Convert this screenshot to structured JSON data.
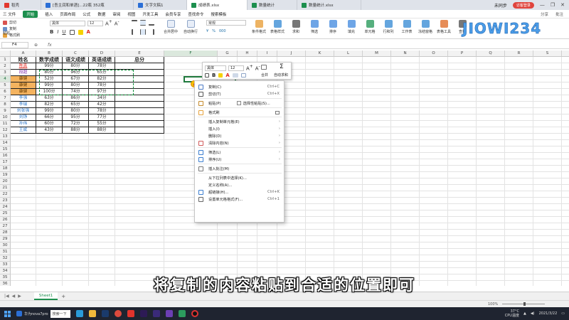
{
  "colors": {
    "accent": "#1d8f4e",
    "orange_fill": "#f4b35f",
    "red_text": "#e0241b",
    "purple_text": "#7a28a8",
    "blue_text": "#2e77c9",
    "selection": "#1f7a3d"
  },
  "tabs": [
    {
      "label": "稻壳",
      "icon": "docer-icon",
      "color": "#e2382e"
    },
    {
      "label": "[吾主润和单酒]...22瓶 352瓶",
      "icon": "doc-icon",
      "color": "#2b6fd6"
    },
    {
      "label": "文字文稿1",
      "icon": "doc-icon",
      "color": "#2b6fd6"
    },
    {
      "label": "成绩表.xlsx",
      "icon": "sheet-icon",
      "color": "#1d8f4e",
      "active": true
    },
    {
      "label": "数量统计",
      "icon": "sheet-icon",
      "color": "#1d8f4e"
    },
    {
      "label": "数量统计.xlsx",
      "icon": "sheet-icon",
      "color": "#1d8f4e"
    }
  ],
  "titlebar": {
    "unlogged": "未同步",
    "vip": "访客登录"
  },
  "menu": {
    "items": [
      "三 文件",
      "开始",
      "插入",
      "页面布局",
      "公式",
      "数据",
      "审阅",
      "视图",
      "开发工具",
      "会员专享",
      "查找命令",
      "搜索模板"
    ],
    "active_index": 1,
    "right": [
      "分享",
      "批注"
    ]
  },
  "ribbon": {
    "cut": "剪切",
    "copy": "复制",
    "format_painter": "格式刷",
    "paste": "粘贴",
    "font": "黑体",
    "size": "12",
    "merge": "合并居中",
    "wrap": "自动换行",
    "numfmt": "常规",
    "large": [
      "条件格式",
      "表格样式",
      "求和",
      "筛选",
      "排序",
      "填充",
      "单元格",
      "行和列",
      "工作表",
      "冻结窗格",
      "表格工具",
      "查找"
    ]
  },
  "watermark": "JIOWI234",
  "formula_bar": {
    "cell_ref": "F4",
    "fx": "fx"
  },
  "columns": [
    "A",
    "B",
    "C",
    "D",
    "E",
    "F",
    "G",
    "H",
    "I",
    "J",
    "K",
    "L",
    "M",
    "N",
    "O",
    "P",
    "Q",
    "R",
    "S",
    "T",
    "U",
    "V"
  ],
  "table": {
    "headers": [
      "姓名",
      "数学成绩",
      "语文成绩",
      "英语成绩",
      "总分"
    ],
    "rows": [
      {
        "name": "陈真",
        "math": "99分",
        "chinese": "80分",
        "english": "78分",
        "style": "red"
      },
      {
        "name": "段超",
        "math": "80分",
        "chinese": "96分",
        "english": "65分",
        "style": "purple"
      },
      {
        "name": "康健",
        "math": "52分",
        "chinese": "67分",
        "english": "82分",
        "style": "orange"
      },
      {
        "name": "康健",
        "math": "99分",
        "chinese": "80分",
        "english": "78分",
        "style": "orange"
      },
      {
        "name": "康健",
        "math": "100分",
        "chinese": "74分",
        "english": "97分",
        "style": "orange"
      },
      {
        "name": "李强",
        "math": "63分",
        "chinese": "86分",
        "english": "34分",
        "style": "blue"
      },
      {
        "name": "李瑞",
        "math": "82分",
        "chinese": "65分",
        "english": "42分",
        "style": "blue"
      },
      {
        "name": "刘张强",
        "math": "99分",
        "chinese": "80分",
        "english": "78分",
        "style": "blue"
      },
      {
        "name": "刘铮",
        "math": "66分",
        "chinese": "95分",
        "english": "77分",
        "style": "blue"
      },
      {
        "name": "孙伟",
        "math": "60分",
        "chinese": "72分",
        "english": "55分",
        "style": "blue"
      },
      {
        "name": "王斌",
        "math": "43分",
        "chinese": "88分",
        "english": "88分",
        "style": "blue"
      }
    ]
  },
  "row_count": 36,
  "mini_toolbar": {
    "font": "黑体",
    "size": "12",
    "merge": "合并",
    "autosum": "自动求和"
  },
  "context_menu": [
    {
      "label": "复制(C)",
      "shortcut": "Ctrl+C",
      "icon": "copy-icon"
    },
    {
      "label": "剪切(T)",
      "shortcut": "Ctrl+X",
      "icon": "scissors-icon"
    },
    {
      "sep": true
    },
    {
      "label": "粘贴(P)",
      "shortcut": "",
      "icon": "paste-icon",
      "extra": "选择性粘贴(S)..."
    },
    {
      "sep": true
    },
    {
      "label": "格式刷",
      "shortcut": "",
      "icon": "brush-icon"
    },
    {
      "sep": true
    },
    {
      "label": "插入复制单元格(E)",
      "shortcut": "",
      "icon": "",
      "arrow": true
    },
    {
      "label": "插入(I)",
      "shortcut": "",
      "icon": "",
      "arrow": true
    },
    {
      "label": "删除(D)",
      "shortcut": "",
      "icon": "",
      "arrow": true
    },
    {
      "label": "清除内容(N)",
      "shortcut": "",
      "icon": "eraser-icon",
      "arrow": true
    },
    {
      "sep": true
    },
    {
      "label": "筛选(L)",
      "shortcut": "",
      "icon": "filter-icon",
      "arrow": true
    },
    {
      "label": "排序(U)",
      "shortcut": "",
      "icon": "sort-icon",
      "arrow": true
    },
    {
      "sep": true
    },
    {
      "label": "插入批注(M)",
      "shortcut": "",
      "icon": "comment-icon"
    },
    {
      "sep": true
    },
    {
      "label": "从下拉列表中选择(K)...",
      "shortcut": "",
      "icon": ""
    },
    {
      "label": "定义名称(A)...",
      "shortcut": "",
      "icon": ""
    },
    {
      "label": "超链接(H)...",
      "shortcut": "Ctrl+K",
      "icon": "link-icon"
    },
    {
      "label": "设置单元格格式(F)...",
      "shortcut": "Ctrl+1",
      "icon": "format-icon"
    }
  ],
  "sheet_tab": "Sheet1",
  "status": {
    "zoom": "100%"
  },
  "subtitle": "将复制的内容粘贴到合适的位置即可",
  "taskbar": {
    "phone": "华为nova7pro",
    "search": "搜索一下",
    "weather": "37°C",
    "cpu": "CPU温度",
    "time": "2021/3/22"
  }
}
